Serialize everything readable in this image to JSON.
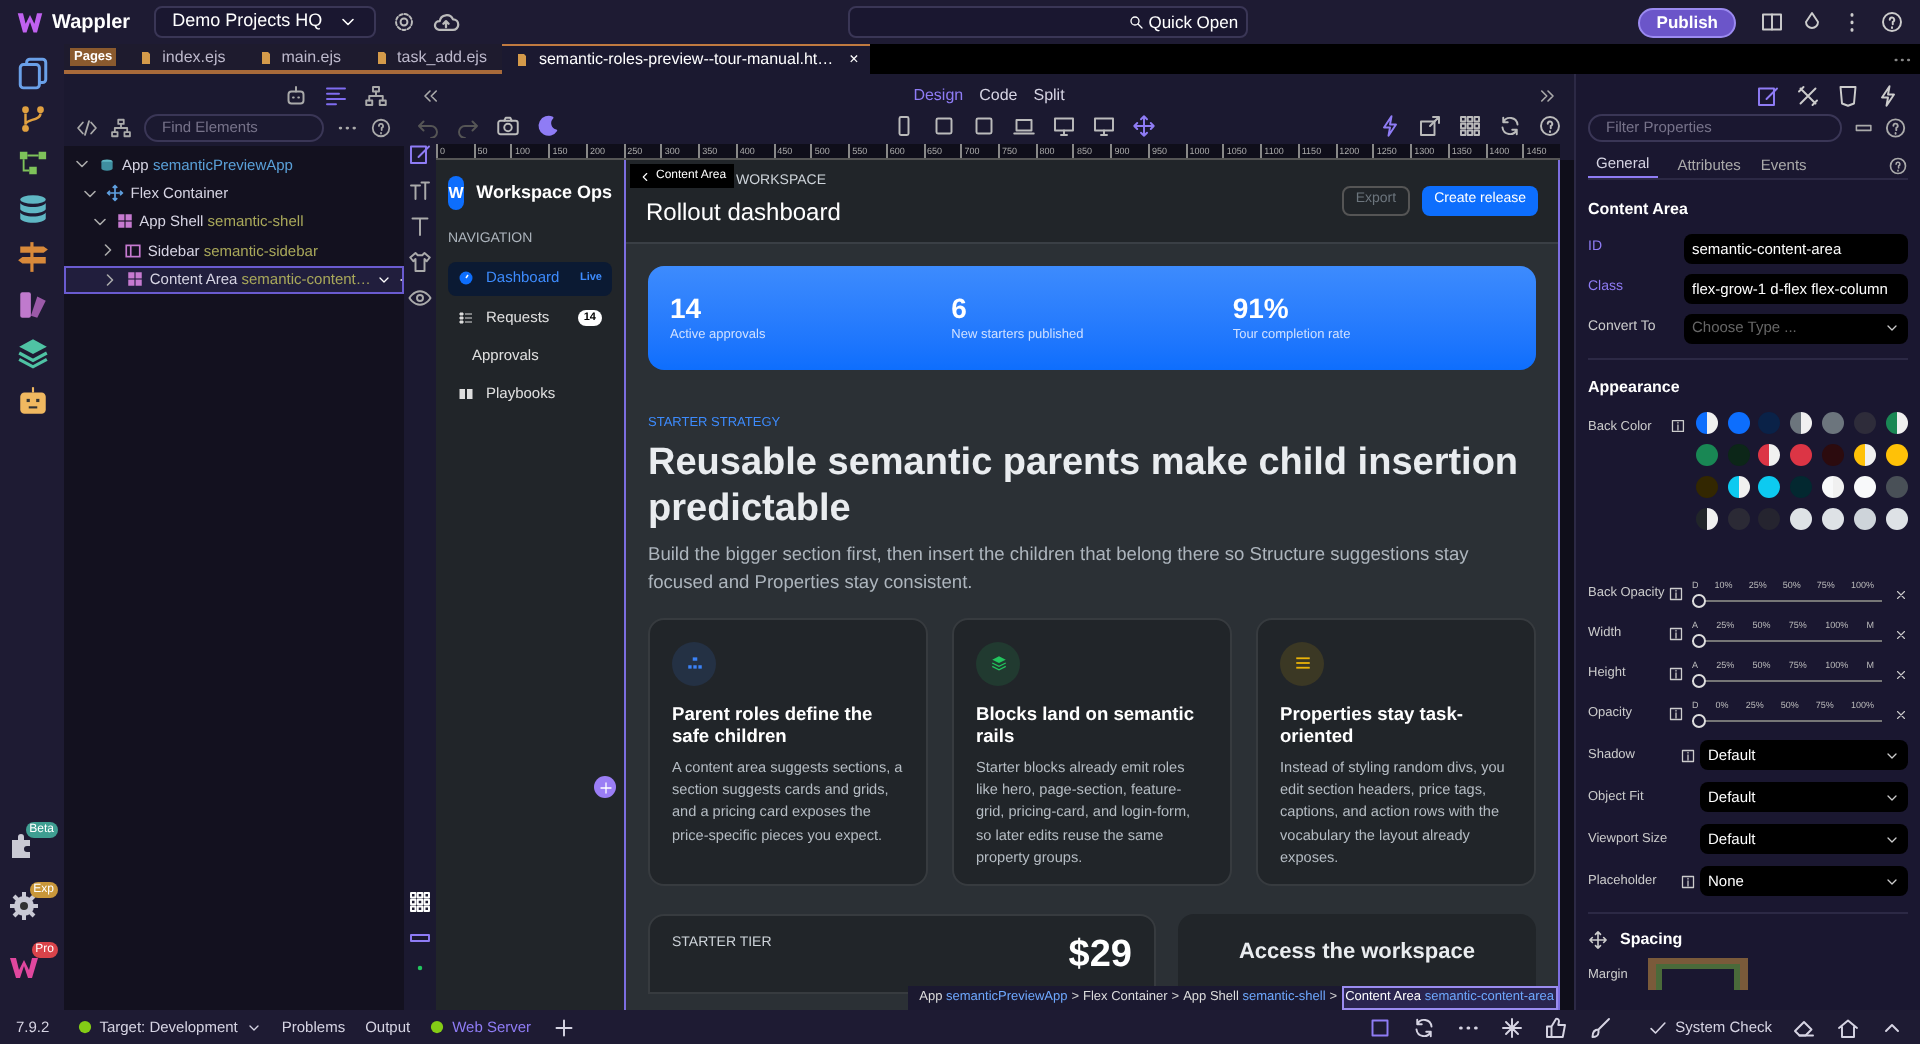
{
  "top_bar": {
    "app_name": "Wappler",
    "project": "Demo Projects HQ",
    "quick_open": "Quick Open",
    "publish": "Publish"
  },
  "activity_bar": {
    "badges": [
      {
        "label": "Beta",
        "color": "#3f9e92"
      },
      {
        "label": "Exp",
        "color": "#c9973a"
      },
      {
        "label": "Pro",
        "color": "#d9434a"
      }
    ]
  },
  "file_tabs": {
    "group": "Pages",
    "tabs": [
      {
        "label": "index.ejs",
        "selected": false
      },
      {
        "label": "main.ejs",
        "selected": false
      },
      {
        "label": "task_add.ejs",
        "selected": false
      },
      {
        "label": "semantic-roles-preview--tour-manual.ht…",
        "selected": true,
        "close": "×"
      }
    ]
  },
  "structure": {
    "search_placeholder": "Find Elements",
    "tree": [
      {
        "kind": "app",
        "label": "App",
        "tag": "semanticPreviewApp",
        "expanded": true,
        "selected": false,
        "children": [
          {
            "kind": "flex",
            "label": "Flex Container",
            "expanded": true,
            "selected": false,
            "children": [
              {
                "kind": "grid",
                "label": "App Shell",
                "tag": "semantic-shell",
                "expanded": true,
                "selected": false,
                "children": [
                  {
                    "kind": "columns",
                    "label": "Sidebar",
                    "tag": "semantic-sidebar",
                    "expanded": false,
                    "selected": false
                  },
                  {
                    "kind": "grid",
                    "label": "Content Area",
                    "tag": "semantic-content…",
                    "expanded": false,
                    "selected": true
                  }
                ]
              }
            ]
          }
        ]
      }
    ]
  },
  "view_modes": [
    {
      "label": "Design",
      "selected": true
    },
    {
      "label": "Code",
      "selected": false
    },
    {
      "label": "Split",
      "selected": false
    }
  ],
  "ruler": [
    "0",
    "50",
    "100",
    "150",
    "200",
    "250",
    "300",
    "350",
    "400",
    "450",
    "500",
    "550",
    "600",
    "650",
    "700",
    "750",
    "800",
    "850",
    "900",
    "950",
    "1000",
    "1050",
    "1100",
    "1150",
    "1200",
    "1250",
    "1300",
    "1350",
    "1400",
    "1450"
  ],
  "preview": {
    "brand_letter": "W",
    "brand": "Workspace Ops",
    "nav_heading": "NAVIGATION",
    "nav": [
      {
        "label": "Dashboard",
        "kind": "gauge",
        "selected": true,
        "badge": "Live"
      },
      {
        "label": "Requests",
        "kind": "list",
        "selected": false,
        "badge": "14"
      },
      {
        "label": "Approvals",
        "kind": "plain",
        "selected": false
      },
      {
        "label": "Playbooks",
        "kind": "book",
        "selected": false
      }
    ],
    "element_tooltip": "Content Area",
    "eyebrow": "WORKSPACE",
    "title": "Rollout dashboard",
    "actions": [
      {
        "label": "Export",
        "kind": "outline"
      },
      {
        "label": "Create release",
        "kind": "primary"
      }
    ],
    "stats": [
      {
        "value": "14",
        "label": "Active approvals"
      },
      {
        "value": "6",
        "label": "New starters published"
      },
      {
        "value": "91%",
        "label": "Tour completion rate"
      }
    ],
    "section": {
      "eyebrow": "STARTER STRATEGY",
      "heading": "Reusable semantic parents make child insertion predictable",
      "lead": "Build the bigger section first, then insert the children that belong there so Structure suggestions stay focused and Properties stay consistent."
    },
    "cards": [
      {
        "kind": "hierarchy",
        "color": "#3b82f6",
        "title": "Parent roles define the safe children",
        "text": "A content area suggests sections, a section suggests cards and grids, and a pricing card exposes the price-specific pieces you expect."
      },
      {
        "kind": "layers",
        "color": "#22c55e",
        "title": "Blocks land on semantic rails",
        "text": "Starter blocks already emit roles like hero, page-section, feature-grid, pricing-card, and login-form, so later edits reuse the same property groups."
      },
      {
        "kind": "sliders",
        "color": "#eab308",
        "title": "Properties stay task-oriented",
        "text": "Instead of styling random divs, you edit section headers, price tags, captions, and action rows with the vocabulary the layout already exposes."
      }
    ],
    "pricing": {
      "tier": "STARTER TIER",
      "price": "$29"
    },
    "access": {
      "heading": "Access the workspace"
    }
  },
  "breadcrumb": [
    {
      "label": "App",
      "tag": "semanticPreviewApp",
      "selected": false
    },
    {
      "sep": ">",
      "label": "Flex Container",
      "selected": false
    },
    {
      "sep": ">",
      "label": "App Shell",
      "tag": "semantic-shell",
      "selected": false
    },
    {
      "sep": ">",
      "label": "Content Area",
      "tag": "semantic-content-area",
      "selected": true
    }
  ],
  "properties": {
    "filter_placeholder": "Filter Properties",
    "tabs": [
      {
        "label": "General",
        "selected": true
      },
      {
        "label": "Attributes",
        "selected": false
      },
      {
        "label": "Events",
        "selected": false
      }
    ],
    "element": "Content Area",
    "fields": [
      {
        "label": "ID",
        "kind": "text",
        "set": true,
        "value": "semantic-content-area"
      },
      {
        "label": "Class",
        "kind": "text",
        "set": true,
        "value": "flex-grow-1 d-flex flex-column"
      },
      {
        "label": "Convert To",
        "kind": "select",
        "set": false,
        "placeholder": "Choose Type ..."
      }
    ],
    "appearance": "Appearance",
    "back_color_label": "Back Color",
    "swatches": [
      {
        "kind": "split",
        "color": "#0d6efd"
      },
      {
        "kind": "solid",
        "color": "#0d6efd"
      },
      {
        "kind": "solid",
        "color": "#0a2248"
      },
      {
        "kind": "split",
        "color": "#6c757d"
      },
      {
        "kind": "solid",
        "color": "#6c757d"
      },
      {
        "kind": "solid",
        "color": "#2e2c3a"
      },
      {
        "kind": "split",
        "color": "#198754"
      },
      {
        "kind": "solid",
        "color": "#198754"
      },
      {
        "kind": "solid",
        "color": "#0c2618"
      },
      {
        "kind": "split",
        "color": "#dc3545"
      },
      {
        "kind": "solid",
        "color": "#dc3545"
      },
      {
        "kind": "solid",
        "color": "#2c0b0e"
      },
      {
        "kind": "split",
        "color": "#ffc107"
      },
      {
        "kind": "solid",
        "color": "#ffc107"
      },
      {
        "kind": "solid",
        "color": "#332701"
      },
      {
        "kind": "split",
        "color": "#0dcaf0"
      },
      {
        "kind": "solid",
        "color": "#0dcaf0"
      },
      {
        "kind": "solid",
        "color": "#032830"
      },
      {
        "kind": "split",
        "color": "#f8f9fa"
      },
      {
        "kind": "solid",
        "color": "#f8f9fa"
      },
      {
        "kind": "solid",
        "color": "#495057"
      },
      {
        "kind": "split",
        "color": "#212529"
      },
      {
        "kind": "solid",
        "color": "#2b2a35"
      },
      {
        "kind": "solid",
        "color": "#25242f"
      },
      {
        "kind": "solid",
        "color": "#dee2e6"
      },
      {
        "kind": "solid",
        "color": "#dee2e6"
      },
      {
        "kind": "solid",
        "color": "#ced4da"
      },
      {
        "kind": "solid",
        "color": "#dee2e6"
      }
    ],
    "sliders": [
      {
        "label": "Back Opacity",
        "marks": [
          "D",
          "10%",
          "25%",
          "50%",
          "75%",
          "100%"
        ],
        "level": 0
      },
      {
        "label": "Width",
        "marks": [
          "A",
          "25%",
          "50%",
          "75%",
          "100%",
          "M"
        ],
        "level": 0
      },
      {
        "label": "Height",
        "marks": [
          "A",
          "25%",
          "50%",
          "75%",
          "100%",
          "M"
        ],
        "level": 0
      },
      {
        "label": "Opacity",
        "marks": [
          "D",
          "0%",
          "25%",
          "50%",
          "75%",
          "100%"
        ],
        "level": 0
      }
    ],
    "selects": [
      {
        "label": "Shadow",
        "value": "Default",
        "info": true
      },
      {
        "label": "Object Fit",
        "value": "Default",
        "info": false
      },
      {
        "label": "Viewport Size",
        "value": "Default",
        "info": false
      },
      {
        "label": "Placeholder",
        "value": "None",
        "info": true
      }
    ],
    "spacing": "Spacing",
    "margin_label": "Margin"
  },
  "status_bar": {
    "version": "7.9.2",
    "target": "Target: Development",
    "items": [
      "Problems",
      "Output"
    ],
    "server": "Web Server",
    "system_check": "System Check"
  }
}
